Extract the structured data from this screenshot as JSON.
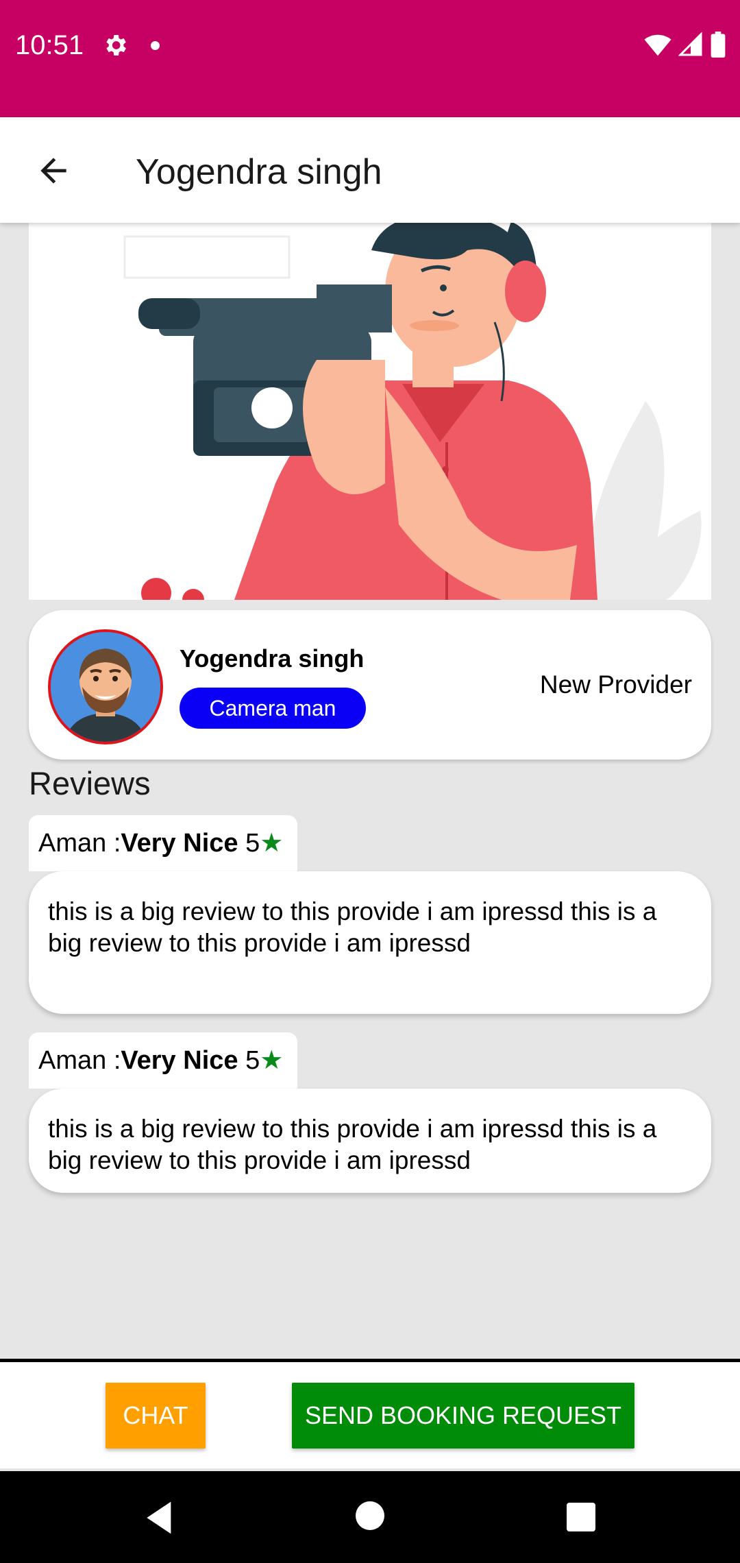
{
  "status_bar": {
    "time": "10:51"
  },
  "app_bar": {
    "title": "Yogendra singh"
  },
  "provider": {
    "name": "Yogendra singh",
    "role": "Camera man",
    "status": "New Provider"
  },
  "reviews_heading": "Reviews",
  "reviews": [
    {
      "reviewer": "Aman :",
      "title": "Very Nice",
      "rating": "5",
      "text": "this is  a big review to this provide i am ipressd this is a big review to this provide i am ipressd"
    },
    {
      "reviewer": "Aman :",
      "title": "Very Nice",
      "rating": "5",
      "text": "this is  a big review to this provide i am ipressd this is a big review to this provide i am ipressd"
    }
  ],
  "actions": {
    "chat_label": "CHAT",
    "booking_label": "SEND BOOKING REQUEST"
  },
  "colors": {
    "status_bar": "#c70063",
    "role_badge": "#0a00f5",
    "chat_button": "#ffa000",
    "booking_button": "#008c08",
    "star": "#0a8a1a"
  },
  "icons": {
    "status": [
      "gear-icon",
      "wifi-icon",
      "signal-icon",
      "battery-icon"
    ],
    "app_bar": [
      "back-arrow-icon"
    ],
    "review": [
      "star-icon"
    ],
    "nav": [
      "nav-back-icon",
      "nav-home-icon",
      "nav-recents-icon"
    ]
  }
}
